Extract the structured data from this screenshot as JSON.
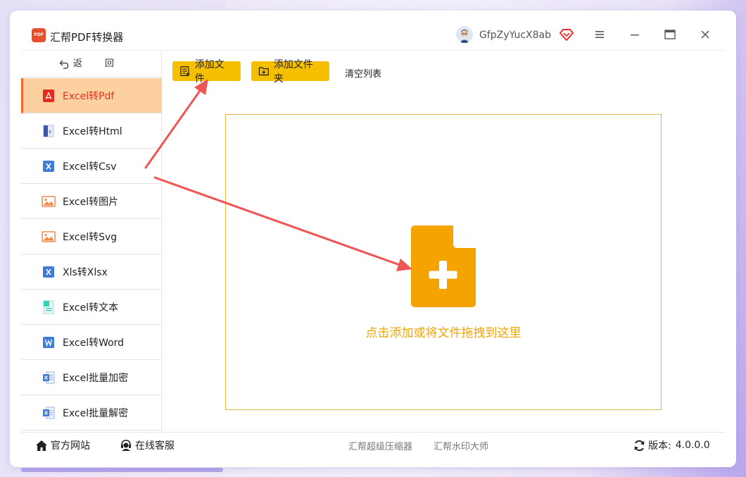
{
  "window": {
    "app_title": "汇帮PDF转换器",
    "logo_text": "PDF",
    "username": "GfpZyYucX8ab"
  },
  "sidebar": {
    "back_label": "返 回",
    "items": [
      {
        "label": "Excel转Pdf",
        "icon": "pdf-icon",
        "active": true
      },
      {
        "label": "Excel转Html",
        "icon": "html-file-icon"
      },
      {
        "label": "Excel转Csv",
        "icon": "excel-x-icon"
      },
      {
        "label": "Excel转图片",
        "icon": "image-icon"
      },
      {
        "label": "Excel转Svg",
        "icon": "image-icon"
      },
      {
        "label": "Xls转Xlsx",
        "icon": "excel-x-icon"
      },
      {
        "label": "Excel转文本",
        "icon": "text-file-icon"
      },
      {
        "label": "Excel转Word",
        "icon": "word-icon"
      },
      {
        "label": "Excel批量加密",
        "icon": "excel-file-icon"
      },
      {
        "label": "Excel批量解密",
        "icon": "excel-file-icon"
      }
    ]
  },
  "toolbar": {
    "add_file": "添加文件",
    "add_folder": "添加文件夹",
    "clear_list": "清空列表"
  },
  "drop_zone": {
    "hint": "点击添加或将文件拖拽到这里"
  },
  "footer": {
    "website": "官方网站",
    "support": "在线客服",
    "link1": "汇帮超级压缩器",
    "link2": "汇帮水印大师",
    "version_label": "版本:",
    "version_number": "4.0.0.0"
  },
  "colors": {
    "accent": "#f6c000",
    "active_bg": "#fdd19f",
    "active_text": "#e8301f",
    "drop_hint": "#f0a500",
    "annotation_arrow": "#f05555"
  }
}
